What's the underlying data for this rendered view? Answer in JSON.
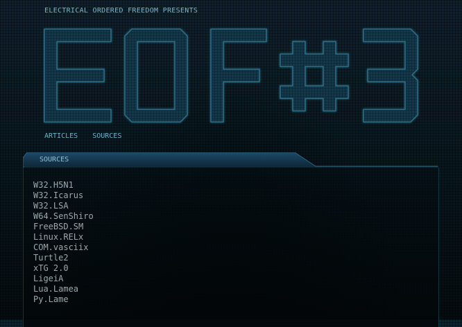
{
  "header": {
    "tagline": "ELECTRICAL ORDERED FREEDOM PRESENTS",
    "logo_text": "EOF#3"
  },
  "nav": {
    "items": [
      {
        "label": "ARTICLES"
      },
      {
        "label": "SOURCES"
      }
    ]
  },
  "panel": {
    "title": "SOURCES",
    "items": [
      "W32.H5N1",
      "W32.Icarus",
      "W32.LSA",
      "W64.SenShiro",
      "FreeBSD.SM",
      "Linux.RELx",
      "COM.vasciix",
      "Turtle2",
      "xTG 2.0",
      "LigeiA",
      "Lua.Lamea",
      "Py.Lame"
    ]
  },
  "colors": {
    "background": "#061015",
    "accent": "#6fb0cc",
    "logo_fill": "#0f3040",
    "logo_stroke": "#2f6e86",
    "list_text": "#9aa8ad"
  }
}
